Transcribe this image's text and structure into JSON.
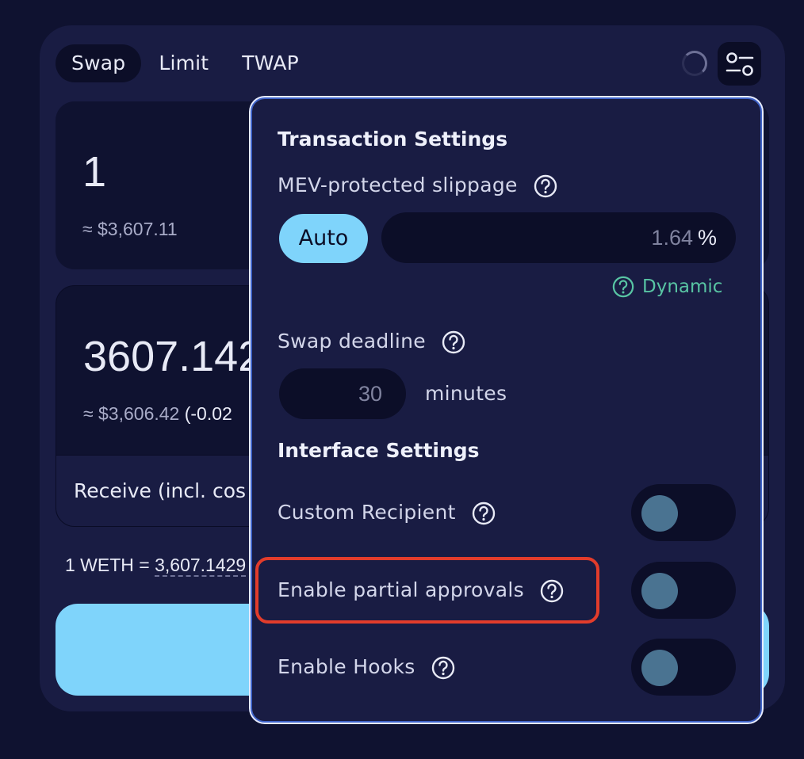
{
  "tabs": [
    {
      "label": "Swap",
      "active": true
    },
    {
      "label": "Limit",
      "active": false
    },
    {
      "label": "TWAP",
      "active": false
    }
  ],
  "sell": {
    "amount": "1",
    "fiat": "≈ $3,607.11"
  },
  "buy": {
    "amount": "3607.142",
    "fiat": "≈ $3,606.42",
    "pct": " (-0.02",
    "receive_label": "Receive (incl. cos"
  },
  "rate": {
    "prefix": "1 WETH = ",
    "value": "3,607.1429"
  },
  "settings": {
    "transaction_title": "Transaction Settings",
    "slippage_label": "MEV-protected slippage",
    "auto_label": "Auto",
    "slippage_value": "1.64",
    "slippage_unit": "%",
    "dynamic_label": "Dynamic",
    "deadline_label": "Swap deadline",
    "deadline_value": "30",
    "deadline_unit": "minutes",
    "interface_title": "Interface Settings",
    "toggles": [
      {
        "label": "Custom Recipient",
        "enabled": false
      },
      {
        "label": "Enable partial approvals",
        "enabled": false
      },
      {
        "label": "Enable Hooks",
        "enabled": false
      }
    ]
  },
  "icons": {
    "settings": "sliders-icon",
    "help": "question-circle-icon",
    "loading": "spinner-icon"
  },
  "colors": {
    "accent": "#7fd4fb",
    "dynamic": "#58c4a3",
    "highlight": "#e23c2b",
    "panel": "#191c43",
    "background": "#0f1230"
  }
}
